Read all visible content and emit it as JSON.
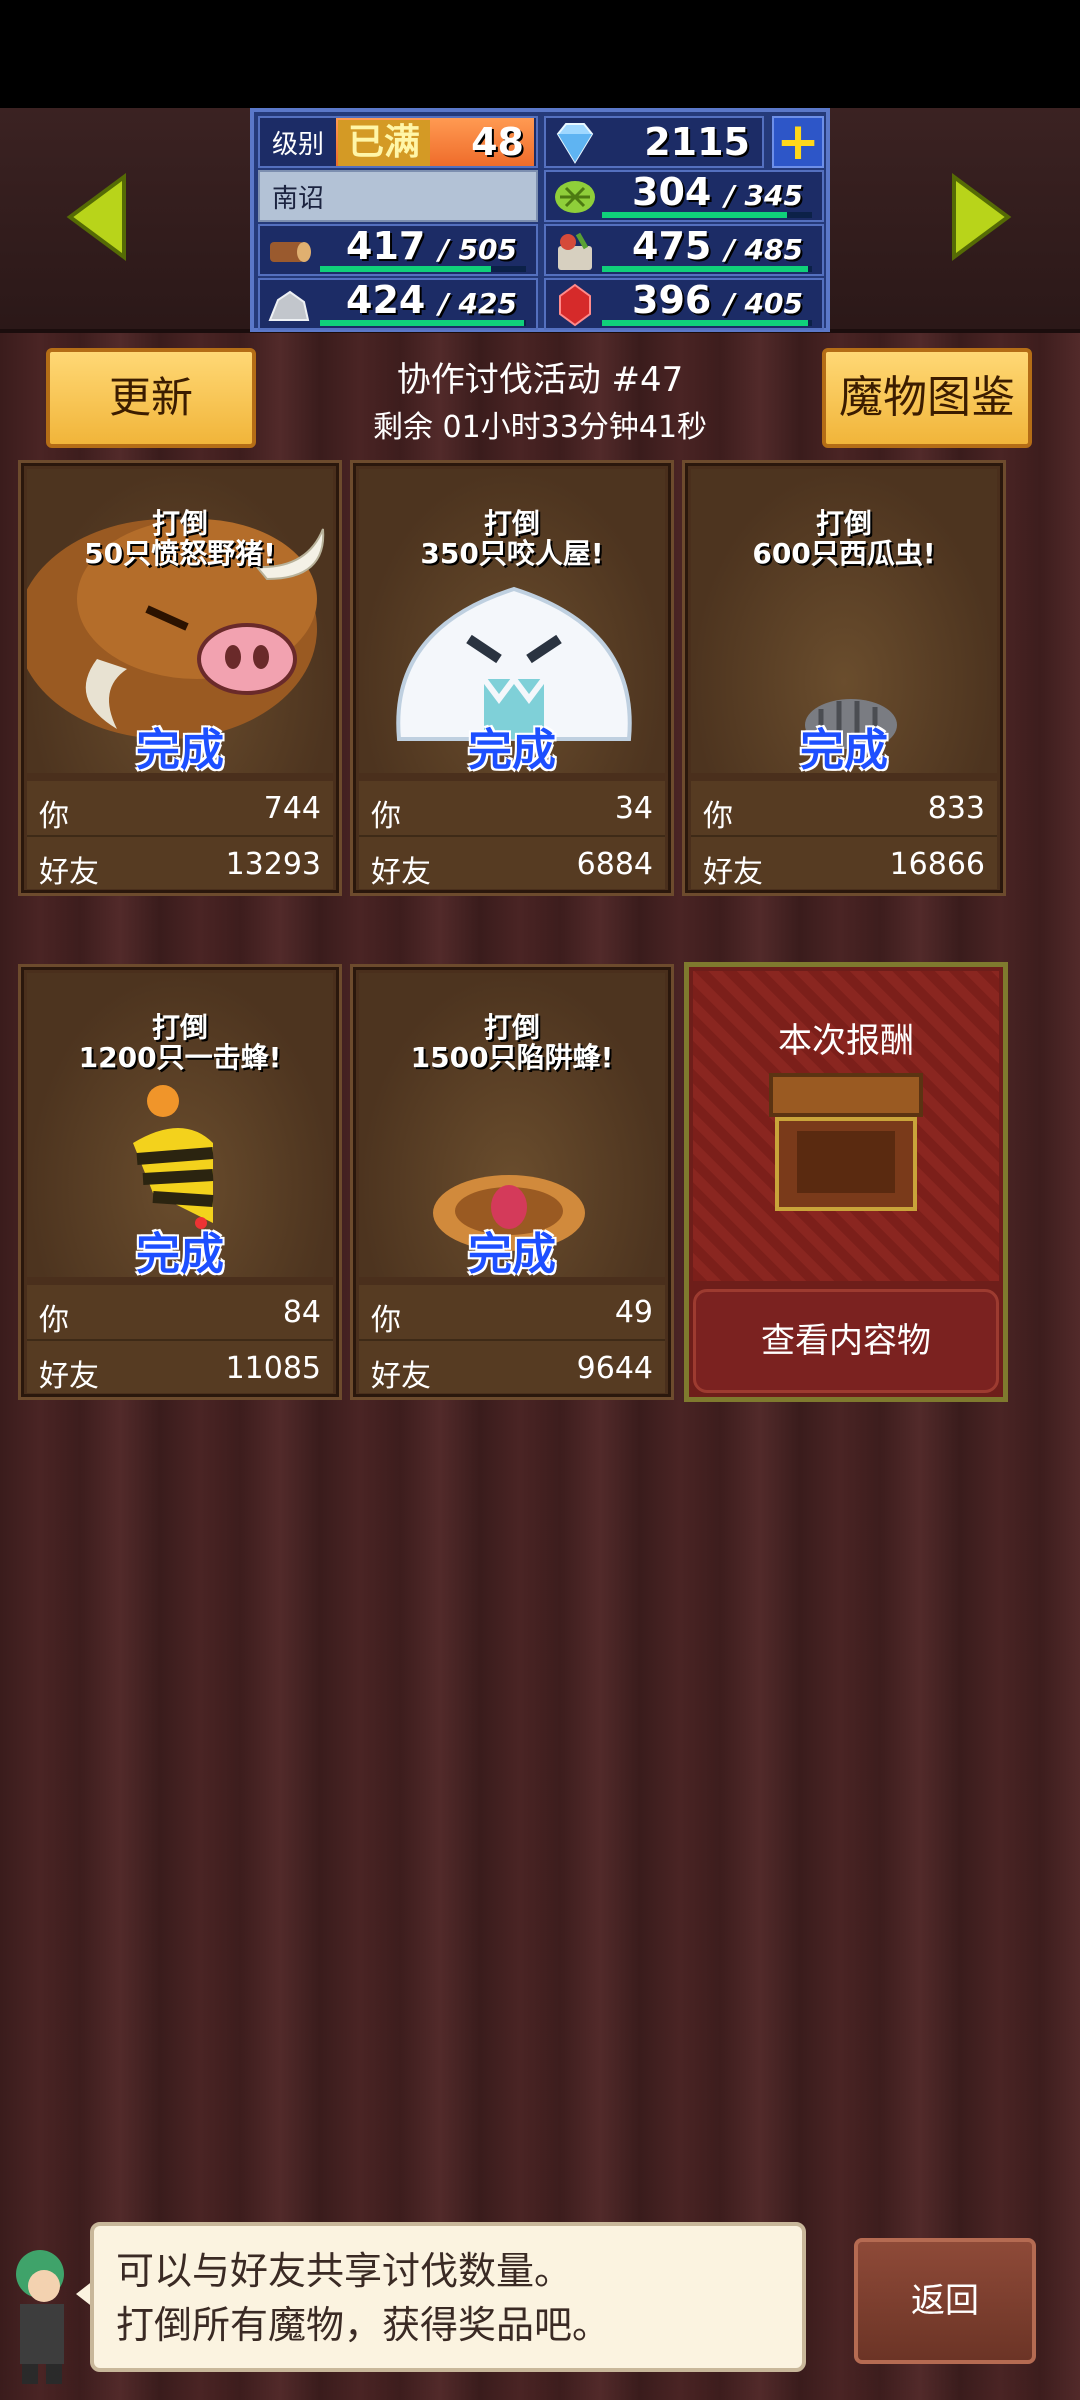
{
  "hud": {
    "level_label": "级别",
    "level_status": "已满",
    "level": "48",
    "gems": "2115",
    "plus_symbol": "+",
    "town_name": "南诏",
    "herb": {
      "current": "304",
      "max": "345",
      "fill": 0.88
    },
    "wood": {
      "current": "417",
      "max": "505",
      "fill": 0.83
    },
    "food": {
      "current": "475",
      "max": "485",
      "fill": 0.98
    },
    "ore": {
      "current": "424",
      "max": "425",
      "fill": 0.99
    },
    "ruby": {
      "current": "396",
      "max": "405",
      "fill": 0.98
    }
  },
  "header": {
    "refresh_label": "更新",
    "monster_book_label": "魔物图鉴",
    "event_title": "协作讨伐活动 #47",
    "time_remaining": "剩余 01小时33分钟41秒"
  },
  "quests": [
    {
      "goal_line1": "打倒",
      "goal_line2": "50只愤怒野猪!",
      "status": "完成",
      "you_label": "你",
      "you": "744",
      "friend_label": "好友",
      "friend": "13293",
      "monster_icon": "angry-boar-icon"
    },
    {
      "goal_line1": "打倒",
      "goal_line2": "350只咬人屋!",
      "status": "完成",
      "you_label": "你",
      "you": "34",
      "friend_label": "好友",
      "friend": "6884",
      "monster_icon": "biting-house-icon"
    },
    {
      "goal_line1": "打倒",
      "goal_line2": "600只西瓜虫!",
      "status": "完成",
      "you_label": "你",
      "you": "833",
      "friend_label": "好友",
      "friend": "16866",
      "monster_icon": "pill-bug-icon"
    },
    {
      "goal_line1": "打倒",
      "goal_line2": "1200只一击蜂!",
      "status": "完成",
      "you_label": "你",
      "you": "84",
      "friend_label": "好友",
      "friend": "11085",
      "monster_icon": "bee-icon"
    },
    {
      "goal_line1": "打倒",
      "goal_line2": "1500只陷阱蜂!",
      "status": "完成",
      "you_label": "你",
      "you": "49",
      "friend_label": "好友",
      "friend": "9644",
      "monster_icon": "trap-bee-icon"
    }
  ],
  "reward": {
    "title": "本次报酬",
    "button_label": "查看内容物"
  },
  "footer": {
    "speech_line1": "可以与好友共享讨伐数量。",
    "speech_line2": "打倒所有魔物，获得奖品吧。",
    "back_label": "返回"
  },
  "colors": {
    "done_text": "#1d4fff",
    "gauge": "#10d07a",
    "button_yellow": "#f1b53a"
  }
}
